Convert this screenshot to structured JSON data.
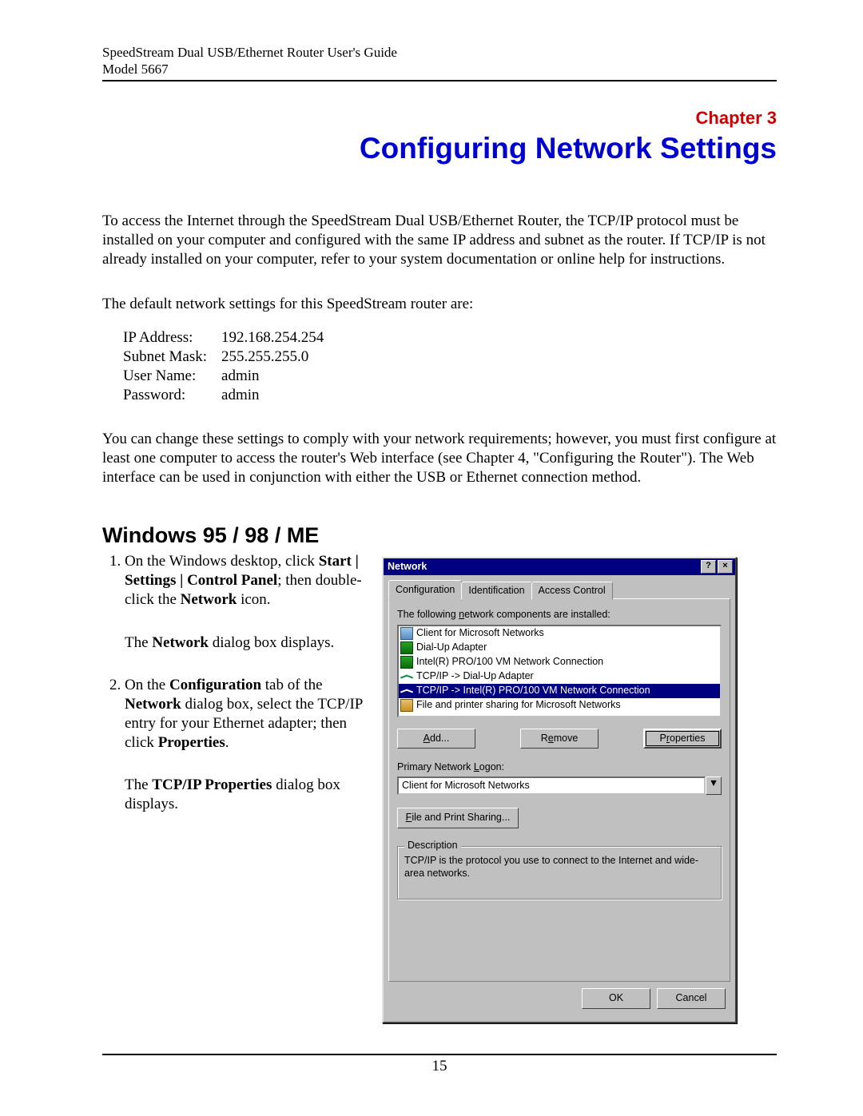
{
  "header": {
    "line1": "SpeedStream Dual USB/Ethernet Router User's Guide",
    "line2": "Model 5667"
  },
  "chapter": {
    "label": "Chapter 3",
    "title": "Configuring Network Settings"
  },
  "intro_para": "To access the Internet through the SpeedStream Dual USB/Ethernet Router, the TCP/IP protocol must be installed on your computer and configured with the same IP address and subnet as the router. If TCP/IP is not already installed on your computer, refer to your system documentation or online help for instructions.",
  "defaults_intro": "The default network settings for this SpeedStream router are:",
  "defaults": [
    {
      "label": "IP Address:",
      "value": "192.168.254.254"
    },
    {
      "label": "Subnet Mask:",
      "value": "255.255.255.0"
    },
    {
      "label": "User Name:",
      "value": "admin"
    },
    {
      "label": "Password:",
      "value": "admin"
    }
  ],
  "change_para": "You can change these settings to comply with your network requirements; however, you must first configure at least one computer to access the router's Web interface (see Chapter 4, \"Configuring the Router\"). The Web interface can be used in conjunction with either the USB or Ethernet connection method.",
  "section_heading": "Windows 95 / 98 / ME",
  "steps": {
    "s1": {
      "pre": "On the Windows desktop, click ",
      "b1": "Start | Settings | Control Panel",
      "mid1": "; then double-click the ",
      "b2": "Network",
      "post1": " icon.",
      "result_pre": "The ",
      "result_b": "Network",
      "result_post": " dialog box displays."
    },
    "s2": {
      "pre": "On the ",
      "b1": "Configuration",
      "mid1": " tab of the ",
      "b2": "Network",
      "mid2": " dialog box, select the TCP/IP entry for your Ethernet adapter; then click ",
      "b3": "Properties",
      "post": ".",
      "result_pre": "The ",
      "result_b": "TCP/IP Properties",
      "result_post": " dialog box displays."
    }
  },
  "dialog": {
    "title": "Network",
    "help_btn": "?",
    "close_btn": "×",
    "tabs": {
      "t1": "Configuration",
      "t2": "Identification",
      "t3": "Access Control"
    },
    "list_label_pre": "The following ",
    "list_label_u": "n",
    "list_label_post": "etwork components are installed:",
    "items": {
      "i0": "Client for Microsoft Networks",
      "i1": "Dial-Up Adapter",
      "i2": "Intel(R) PRO/100 VM Network Connection",
      "i3": "TCP/IP -> Dial-Up Adapter",
      "i4": "TCP/IP -> Intel(R) PRO/100 VM Network Connection",
      "i5": "File and printer sharing for Microsoft Networks"
    },
    "buttons": {
      "add_u": "A",
      "add_rest": "dd...",
      "remove_pre": "R",
      "remove_u": "e",
      "remove_post": "move",
      "properties_pre": "P",
      "properties_u": "r",
      "properties_post": "operties"
    },
    "logon_label_pre": "Primary Network ",
    "logon_label_u": "L",
    "logon_label_post": "ogon:",
    "logon_value": "Client for Microsoft Networks",
    "sharing_btn_u": "F",
    "sharing_btn_rest": "ile and Print Sharing...",
    "group_legend": "Description",
    "group_text": "TCP/IP is the protocol you use to connect to the Internet and wide-area networks.",
    "ok": "OK",
    "cancel": "Cancel",
    "dd_arrow": "▼"
  },
  "page_number": "15"
}
